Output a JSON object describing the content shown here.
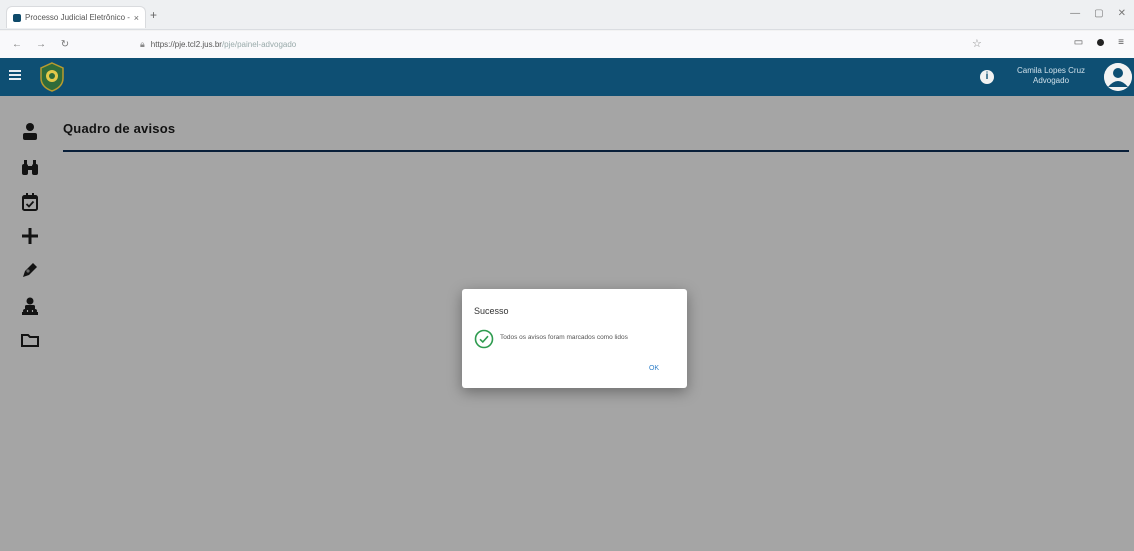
{
  "browser": {
    "tab_label": "Processo Judicial Eletrônico - ESTA",
    "tab_close": "×",
    "new_tab": "+",
    "url_host": "https://pje.tcl2.jus.br",
    "url_path": "/pje/painel-advogado",
    "nav_back": "←",
    "nav_forward": "→",
    "nav_reload": "↻",
    "win_minimize": "—",
    "win_maximize": "▢",
    "win_close": "✕"
  },
  "header": {
    "info_label": "i",
    "user_name": "Camila Lopes Cruz",
    "user_role": "Advogado"
  },
  "page": {
    "title": "Quadro de avisos"
  },
  "dialog": {
    "title": "Sucesso",
    "message": "Todos os avisos foram marcados como lidos",
    "ok_label": "OK"
  },
  "colors": {
    "appbar": "#0e4f73",
    "rule": "#0e2f55",
    "success": "#2e9b4f",
    "ok_text": "#2f7fc8"
  },
  "icons": {
    "side_nav": [
      "person-icon",
      "binoculars-icon",
      "calendar-check-icon",
      "plus-icon",
      "pen-icon",
      "user-group-icon",
      "folder-icon"
    ]
  }
}
